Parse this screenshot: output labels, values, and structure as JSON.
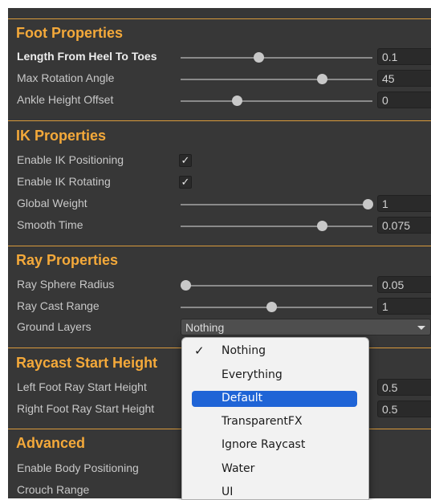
{
  "sections": {
    "foot": {
      "title": "Foot Properties",
      "rows": [
        {
          "label": "Length From Heel To Toes",
          "slider": 0.41,
          "value": "0.1"
        },
        {
          "label": "Max Rotation Angle",
          "slider": 0.74,
          "value": "45"
        },
        {
          "label": "Ankle Height Offset",
          "slider": 0.29,
          "value": "0"
        }
      ]
    },
    "ik": {
      "title": "IK Properties",
      "enable_positioning": {
        "label": "Enable IK Positioning",
        "checked": true,
        "mark": "✓"
      },
      "enable_rotating": {
        "label": "Enable IK Rotating",
        "checked": true,
        "mark": "✓"
      },
      "global_weight": {
        "label": "Global Weight",
        "slider": 1.0,
        "value": "1"
      },
      "smooth_time": {
        "label": "Smooth Time",
        "slider": 0.75,
        "value": "0.075"
      }
    },
    "ray": {
      "title": "Ray Properties",
      "sphere_radius": {
        "label": "Ray Sphere Radius",
        "slider": 0.0,
        "value": "0.05"
      },
      "cast_range": {
        "label": "Ray Cast Range",
        "slider": 0.47,
        "value": "1"
      },
      "ground_layers": {
        "label": "Ground Layers",
        "value": "Nothing"
      }
    },
    "raycast": {
      "title": "Raycast Start Height",
      "left": {
        "label": "Left Foot Ray Start Height",
        "value": "0.5"
      },
      "right": {
        "label": "Right Foot Ray Start Height",
        "value": "0.5"
      }
    },
    "advanced": {
      "title": "Advanced",
      "body_positioning": {
        "label": "Enable Body Positioning"
      },
      "crouch_range": {
        "label": "Crouch Range"
      }
    }
  },
  "layer_menu": {
    "check_mark": "✓",
    "options": [
      "Nothing",
      "Everything",
      "Default",
      "TransparentFX",
      "Ignore Raycast",
      "Water",
      "UI"
    ],
    "checked": "Nothing",
    "highlighted": "Default"
  },
  "colors": {
    "panel_bg": "#373737",
    "section_title": "#f4a93a",
    "menu_highlight": "#1f64d6"
  }
}
